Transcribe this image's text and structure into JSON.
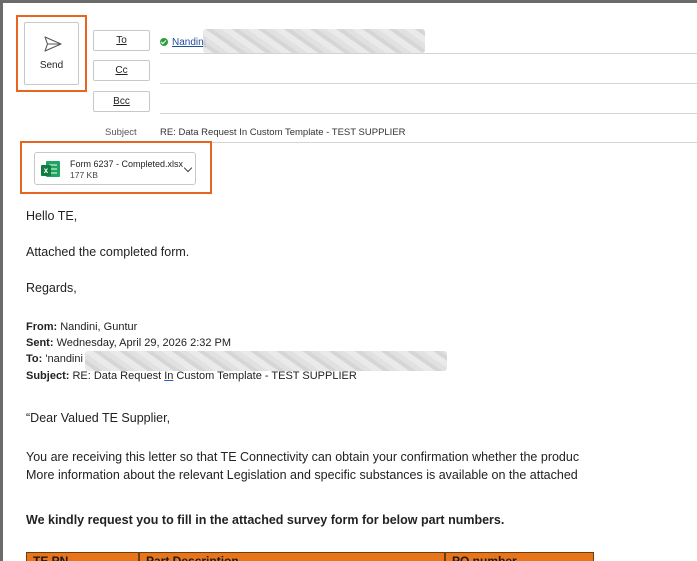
{
  "compose": {
    "send_label": "Send",
    "to_label": "To",
    "cc_label": "Cc",
    "bcc_label": "Bcc",
    "to_recipient": "Nandini",
    "subject_label": "Subject",
    "subject_value": "RE: Data Request In Custom Template - TEST SUPPLIER"
  },
  "attachment": {
    "name": "Form 6237 - Completed.xlsx",
    "size": "177 KB",
    "icon": "excel-icon"
  },
  "body": {
    "greeting": "Hello TE,",
    "line1": "Attached the completed form.",
    "signoff": "Regards,"
  },
  "quoted": {
    "from_label": "From:",
    "from_value": "Nandini, Guntur",
    "sent_label": "Sent:",
    "sent_value": "Wednesday, April 29, 2026 2:32 PM",
    "to_label": "To:",
    "to_value": "'nandini",
    "subject_label": "Subject:",
    "subject_pre": "RE: Data Request ",
    "subject_in": "In",
    "subject_post": " Custom Template - TEST SUPPLIER",
    "salutation": "“Dear Valued TE Supplier,",
    "para_line1": "You are receiving this letter so that TE Connectivity can obtain your confirmation whether the produc",
    "para_line2": "More information about the relevant Legislation and specific substances is available on the attached",
    "request": "We kindly request you to fill in the attached survey form for below part numbers."
  },
  "table": {
    "headers": [
      "TE PN",
      "Part Description",
      "PO number"
    ]
  },
  "colors": {
    "highlight": "#e8651f",
    "excel_green": "#107c41",
    "table_header": "#e8751a"
  }
}
